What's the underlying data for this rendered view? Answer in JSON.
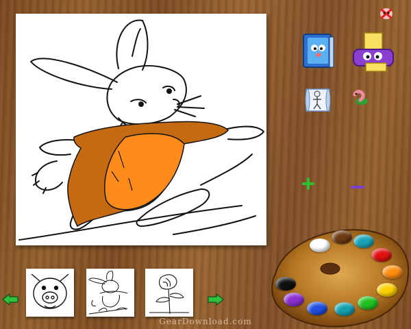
{
  "app": {
    "watermark": "GearDownload.com"
  },
  "canvas": {
    "fill_colors": {
      "body": "#ff8c1a",
      "arms": "#c46a12"
    }
  },
  "toolbar": {
    "tools": [
      {
        "id": "book",
        "icon": "book-icon"
      },
      {
        "id": "printer",
        "icon": "printer-icon"
      },
      {
        "id": "scroll",
        "icon": "picture-scroll-icon"
      },
      {
        "id": "worm",
        "icon": "worm-icon"
      }
    ],
    "close_icon": "close-icon",
    "zoom_in_icon": "plus-icon",
    "zoom_out_icon": "minus-icon"
  },
  "thumbnails": [
    {
      "subject": "pig"
    },
    {
      "subject": "rabbit"
    },
    {
      "subject": "flower"
    }
  ],
  "palette": {
    "colors": [
      "#ffffff",
      "#6b3a12",
      "#1aa3b8",
      "#e01010",
      "#ff8c10",
      "#ffd000",
      "#20c020",
      "#12a0b0",
      "#1f4fe0",
      "#8a2fd0",
      "#111111"
    ]
  }
}
